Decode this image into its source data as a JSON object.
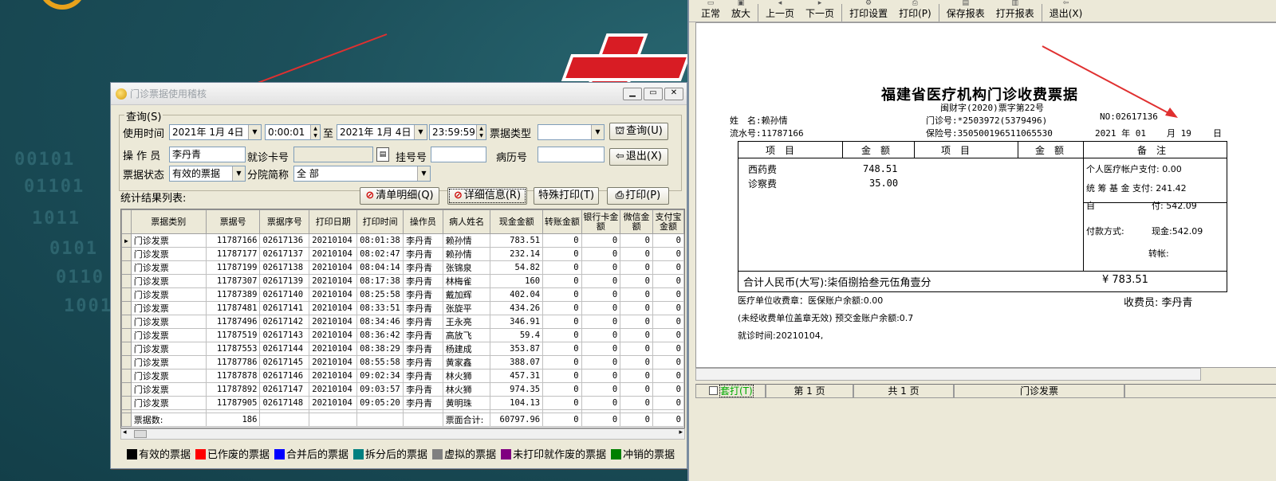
{
  "desktop": {
    "binary_lines": [
      "00101",
      "01101",
      "1011",
      "0101",
      "0110",
      "1001"
    ]
  },
  "window_a": {
    "title": "门诊票据使用稽核",
    "query_group": "查询(S)",
    "labels": {
      "use_time": "使用时间",
      "to": "至",
      "ticket_type": "票据类型",
      "operator": "操 作 员",
      "card_no": "就诊卡号",
      "reg_no": "挂号号",
      "record_no": "病历号",
      "ticket_status": "票据状态",
      "branch": "分院简称",
      "result_list": "统计结果列表:"
    },
    "values": {
      "date_from": "2021年 1月 4日",
      "time_from": "0:00:01",
      "date_to": "2021年 1月 4日",
      "time_to": "23:59:59",
      "ticket_type": "",
      "operator": "李丹青",
      "card_no": "",
      "reg_no": "",
      "record_no": "",
      "ticket_status": "有效的票据",
      "branch": "全 部"
    },
    "buttons": {
      "query": "查询(U)",
      "exit": "退出(X)",
      "clear": "清单明细(Q)",
      "detail": "详细信息(R)",
      "special_print": "特殊打印(T)",
      "print": "打印(P)"
    },
    "columns": [
      "票据类别",
      "票据号",
      "票据序号",
      "打印日期",
      "打印时间",
      "操作员",
      "病人姓名",
      "现金金额",
      "转账金额",
      "银行卡金额",
      "微信金额",
      "支付宝金额"
    ],
    "rows": [
      [
        "门诊发票",
        "11787166",
        "02617136",
        "20210104",
        "08:01:38",
        "李丹青",
        "赖孙情",
        "783.51",
        "0",
        "0",
        "0",
        "0"
      ],
      [
        "门诊发票",
        "11787177",
        "02617137",
        "20210104",
        "08:02:47",
        "李丹青",
        "赖孙情",
        "232.14",
        "0",
        "0",
        "0",
        "0"
      ],
      [
        "门诊发票",
        "11787199",
        "02617138",
        "20210104",
        "08:04:14",
        "李丹青",
        "张锦泉",
        "54.82",
        "0",
        "0",
        "0",
        "0"
      ],
      [
        "门诊发票",
        "11787307",
        "02617139",
        "20210104",
        "08:17:38",
        "李丹青",
        "林梅雀",
        "160",
        "0",
        "0",
        "0",
        "0"
      ],
      [
        "门诊发票",
        "11787389",
        "02617140",
        "20210104",
        "08:25:58",
        "李丹青",
        "戴加辉",
        "402.04",
        "0",
        "0",
        "0",
        "0"
      ],
      [
        "门诊发票",
        "11787481",
        "02617141",
        "20210104",
        "08:33:51",
        "李丹青",
        "张旋平",
        "434.26",
        "0",
        "0",
        "0",
        "0"
      ],
      [
        "门诊发票",
        "11787496",
        "02617142",
        "20210104",
        "08:34:46",
        "李丹青",
        "王永亮",
        "346.91",
        "0",
        "0",
        "0",
        "0"
      ],
      [
        "门诊发票",
        "11787519",
        "02617143",
        "20210104",
        "08:36:42",
        "李丹青",
        "高放飞",
        "59.4",
        "0",
        "0",
        "0",
        "0"
      ],
      [
        "门诊发票",
        "11787553",
        "02617144",
        "20210104",
        "08:38:29",
        "李丹青",
        "杨建成",
        "353.87",
        "0",
        "0",
        "0",
        "0"
      ],
      [
        "门诊发票",
        "11787786",
        "02617145",
        "20210104",
        "08:55:58",
        "李丹青",
        "黄家鑫",
        "388.07",
        "0",
        "0",
        "0",
        "0"
      ],
      [
        "门诊发票",
        "11787878",
        "02617146",
        "20210104",
        "09:02:34",
        "李丹青",
        "林火狮",
        "457.31",
        "0",
        "0",
        "0",
        "0"
      ],
      [
        "门诊发票",
        "11787892",
        "02617147",
        "20210104",
        "09:03:57",
        "李丹青",
        "林火狮",
        "974.35",
        "0",
        "0",
        "0",
        "0"
      ],
      [
        "门诊发票",
        "11787905",
        "02617148",
        "20210104",
        "09:05:20",
        "李丹青",
        "黄明珠",
        "104.13",
        "0",
        "0",
        "0",
        "0"
      ]
    ],
    "footer_row": [
      "票据数:",
      "186",
      "",
      "",
      "",
      "",
      "票面合计:",
      "60797.96",
      "0",
      "0",
      "0",
      "0"
    ],
    "legend": [
      {
        "label": "有效的票据",
        "color": "#000000"
      },
      {
        "label": "已作废的票据",
        "color": "#ff0000"
      },
      {
        "label": "合并后的票据",
        "color": "#0000ff"
      },
      {
        "label": "拆分后的票据",
        "color": "#008080"
      },
      {
        "label": "虚拟的票据",
        "color": "#808080"
      },
      {
        "label": "未打印就作废的票据",
        "color": "#800080"
      },
      {
        "label": "冲销的票据",
        "color": "#008000"
      }
    ]
  },
  "window_b": {
    "toolbar": [
      "正常",
      "放大",
      "上一页",
      "下一页",
      "打印设置",
      "打印(P)",
      "保存报表",
      "打开报表",
      "退出(X)"
    ],
    "receipt": {
      "title": "福建省医疗机构门诊收费票据",
      "subtitle": "闽财字(2020)票字第22号",
      "name_label": "姓　名:赖孙情",
      "serial_label": "流水号:11787166",
      "clinic_no": "门诊号:*2503972(5379496)",
      "insurance_no": "保险号:350500196511065530",
      "no": "NO:02617136",
      "date_year": "2021 年 01",
      "date_month": "月 19",
      "date_day": "日",
      "headers": [
        "项　目",
        "金　额",
        "项　目",
        "金　额",
        "备　注"
      ],
      "items": [
        {
          "name": "西药费",
          "amount": "748.51"
        },
        {
          "name": "诊察费",
          "amount": "35.00"
        }
      ],
      "remarks": [
        "个人医疗帐户支付: 0.00",
        "统 筹 基 金 支付: 241.42",
        "自",
        "付: 542.09"
      ],
      "payment_label": "付款方式:",
      "payment_cash": "现金:542.09",
      "payment_transfer": "转帐:",
      "total_text": "合计人民币(大写):柒佰捌拾叁元伍角壹分",
      "total_amount": "¥ 783.51",
      "footer1": "医疗单位收费章：医保账户余额:0.00",
      "cashier": "收费员: 李丹青",
      "footer2": "(未经收费单位盖章无效) 预交金账户余额:0.7",
      "footer3": "就诊时间:20210104,"
    },
    "status": {
      "checkbox_label": "套打(T)",
      "page": "第 1 页",
      "total": "共 1 页",
      "report": "门诊发票"
    }
  }
}
